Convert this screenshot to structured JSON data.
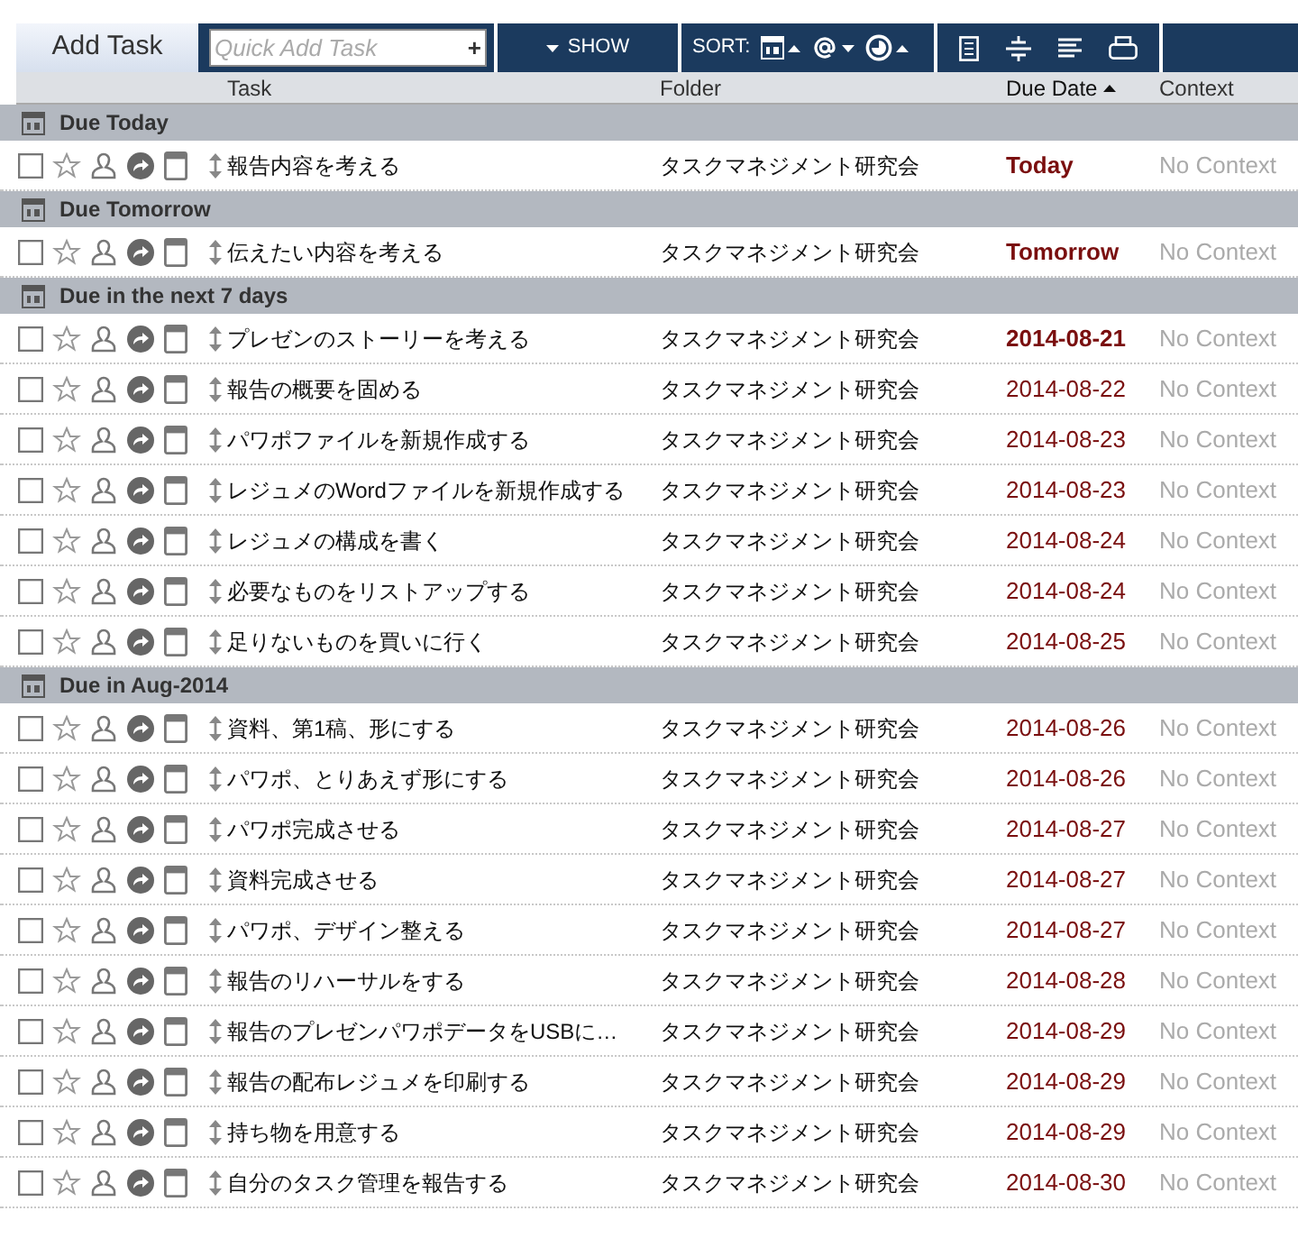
{
  "toolbar": {
    "add_button": "Add Task",
    "quick_add": {
      "placeholder": "Quick Add Task",
      "button": "+"
    },
    "show": "SHOW",
    "sort_label": "SORT:"
  },
  "columns": [
    {
      "label": "Task",
      "sorted": false
    },
    {
      "label": "Folder",
      "sorted": false
    },
    {
      "label": "Due Date",
      "sorted": true
    },
    {
      "label": "Context",
      "sorted": false
    }
  ],
  "sections": [
    {
      "title": "Due Today",
      "tasks": [
        {
          "checked": false,
          "title": "報告内容を考える",
          "folder": "タスクマネジメント研究会",
          "due": "Today",
          "bold": true,
          "context": "No Context"
        }
      ]
    },
    {
      "title": "Due Tomorrow",
      "tasks": [
        {
          "checked": false,
          "title": "伝えたい内容を考える",
          "folder": "タスクマネジメント研究会",
          "due": "Tomorrow",
          "bold": true,
          "context": "No Context"
        }
      ]
    },
    {
      "title": "Due in the next 7 days",
      "tasks": [
        {
          "checked": false,
          "title": "プレゼンのストーリーを考える",
          "folder": "タスクマネジメント研究会",
          "due": "2014-08-21",
          "bold": true,
          "context": "No Context"
        },
        {
          "checked": false,
          "title": "報告の概要を固める",
          "folder": "タスクマネジメント研究会",
          "due": "2014-08-22",
          "bold": false,
          "context": "No Context"
        },
        {
          "checked": false,
          "title": "パワポファイルを新規作成する",
          "folder": "タスクマネジメント研究会",
          "due": "2014-08-23",
          "bold": false,
          "context": "No Context"
        },
        {
          "checked": false,
          "title": "レジュメのWordファイルを新規作成する",
          "folder": "タスクマネジメント研究会",
          "due": "2014-08-23",
          "bold": false,
          "context": "No Context"
        },
        {
          "checked": false,
          "title": "レジュメの構成を書く",
          "folder": "タスクマネジメント研究会",
          "due": "2014-08-24",
          "bold": false,
          "context": "No Context"
        },
        {
          "checked": false,
          "title": "必要なものをリストアップする",
          "folder": "タスクマネジメント研究会",
          "due": "2014-08-24",
          "bold": false,
          "context": "No Context"
        },
        {
          "checked": false,
          "title": "足りないものを買いに行く",
          "folder": "タスクマネジメント研究会",
          "due": "2014-08-25",
          "bold": false,
          "context": "No Context"
        }
      ]
    },
    {
      "title": "Due in Aug-2014",
      "tasks": [
        {
          "checked": false,
          "title": "資料、第1稿、形にする",
          "folder": "タスクマネジメント研究会",
          "due": "2014-08-26",
          "bold": false,
          "context": "No Context"
        },
        {
          "checked": false,
          "title": "パワポ、とりあえず形にする",
          "folder": "タスクマネジメント研究会",
          "due": "2014-08-26",
          "bold": false,
          "context": "No Context"
        },
        {
          "checked": false,
          "title": "パワポ完成させる",
          "folder": "タスクマネジメント研究会",
          "due": "2014-08-27",
          "bold": false,
          "context": "No Context"
        },
        {
          "checked": false,
          "title": "資料完成させる",
          "folder": "タスクマネジメント研究会",
          "due": "2014-08-27",
          "bold": false,
          "context": "No Context"
        },
        {
          "checked": false,
          "title": "パワポ、デザイン整える",
          "folder": "タスクマネジメント研究会",
          "due": "2014-08-27",
          "bold": false,
          "context": "No Context"
        },
        {
          "checked": false,
          "title": "報告のリハーサルをする",
          "folder": "タスクマネジメント研究会",
          "due": "2014-08-28",
          "bold": false,
          "context": "No Context"
        },
        {
          "checked": false,
          "title": "報告のプレゼンパワポデータをUSBに…",
          "folder": "タスクマネジメント研究会",
          "due": "2014-08-29",
          "bold": false,
          "context": "No Context"
        },
        {
          "checked": false,
          "title": "報告の配布レジュメを印刷する",
          "folder": "タスクマネジメント研究会",
          "due": "2014-08-29",
          "bold": false,
          "context": "No Context"
        },
        {
          "checked": false,
          "title": "持ち物を用意する",
          "folder": "タスクマネジメント研究会",
          "due": "2014-08-29",
          "bold": false,
          "context": "No Context"
        },
        {
          "checked": false,
          "title": "自分のタスク管理を報告する",
          "folder": "タスクマネジメント研究会",
          "due": "2014-08-30",
          "bold": false,
          "context": "No Context"
        }
      ]
    }
  ]
}
